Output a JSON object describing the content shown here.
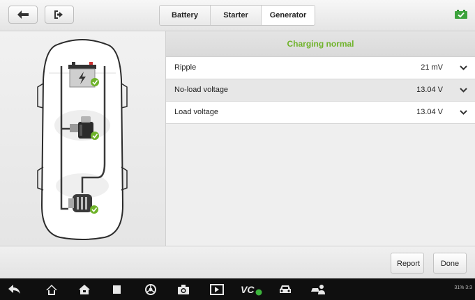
{
  "toolbar": {
    "back_icon": "back-arrow-icon",
    "exit_icon": "exit-icon",
    "tabs": [
      {
        "label": "Battery",
        "active": false
      },
      {
        "label": "Starter",
        "active": false
      },
      {
        "label": "Generator",
        "active": true
      }
    ],
    "battery_status_icon": "battery-ok-icon"
  },
  "diagram": {
    "components": [
      "battery",
      "starter",
      "generator"
    ],
    "status_icon": "check-icon",
    "accent_color": "#6fb32a"
  },
  "results": {
    "status": "Charging normal",
    "rows": [
      {
        "label": "Ripple",
        "value": "21 mV"
      },
      {
        "label": "No-load voltage",
        "value": "13.04 V"
      },
      {
        "label": "Load voltage",
        "value": "13.04 V"
      }
    ]
  },
  "actions": {
    "report_label": "Report",
    "done_label": "Done"
  },
  "system_bar": {
    "icons": [
      "back-icon",
      "home-icon",
      "house-icon",
      "recent-apps-icon",
      "browser-icon",
      "camera-icon",
      "screenshot-icon",
      "vci-icon",
      "car-icon",
      "remote-expert-icon"
    ],
    "status_text": "31% 3:3"
  }
}
